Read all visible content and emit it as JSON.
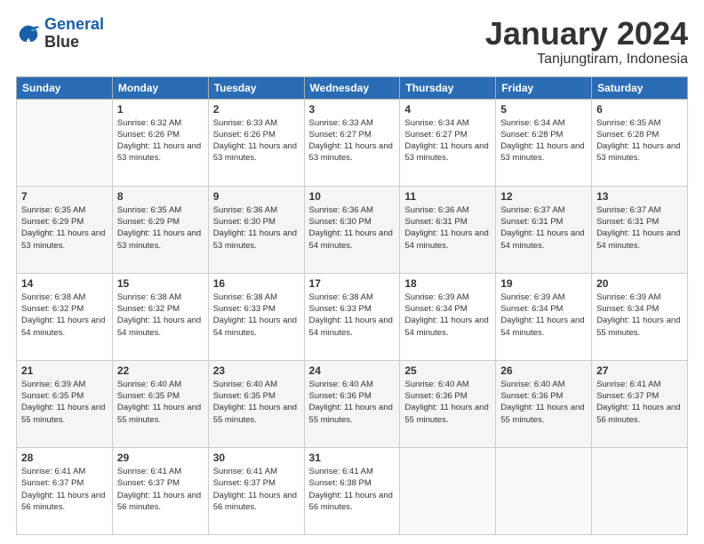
{
  "header": {
    "logo_line1": "General",
    "logo_line2": "Blue",
    "title": "January 2024",
    "subtitle": "Tanjungtiram, Indonesia"
  },
  "days_of_week": [
    "Sunday",
    "Monday",
    "Tuesday",
    "Wednesday",
    "Thursday",
    "Friday",
    "Saturday"
  ],
  "weeks": [
    [
      {
        "day": "",
        "sunrise": "",
        "sunset": "",
        "daylight": ""
      },
      {
        "day": "1",
        "sunrise": "6:32 AM",
        "sunset": "6:26 PM",
        "daylight": "11 hours and 53 minutes."
      },
      {
        "day": "2",
        "sunrise": "6:33 AM",
        "sunset": "6:26 PM",
        "daylight": "11 hours and 53 minutes."
      },
      {
        "day": "3",
        "sunrise": "6:33 AM",
        "sunset": "6:27 PM",
        "daylight": "11 hours and 53 minutes."
      },
      {
        "day": "4",
        "sunrise": "6:34 AM",
        "sunset": "6:27 PM",
        "daylight": "11 hours and 53 minutes."
      },
      {
        "day": "5",
        "sunrise": "6:34 AM",
        "sunset": "6:28 PM",
        "daylight": "11 hours and 53 minutes."
      },
      {
        "day": "6",
        "sunrise": "6:35 AM",
        "sunset": "6:28 PM",
        "daylight": "11 hours and 53 minutes."
      }
    ],
    [
      {
        "day": "7",
        "sunrise": "6:35 AM",
        "sunset": "6:29 PM",
        "daylight": "11 hours and 53 minutes."
      },
      {
        "day": "8",
        "sunrise": "6:35 AM",
        "sunset": "6:29 PM",
        "daylight": "11 hours and 53 minutes."
      },
      {
        "day": "9",
        "sunrise": "6:36 AM",
        "sunset": "6:30 PM",
        "daylight": "11 hours and 53 minutes."
      },
      {
        "day": "10",
        "sunrise": "6:36 AM",
        "sunset": "6:30 PM",
        "daylight": "11 hours and 54 minutes."
      },
      {
        "day": "11",
        "sunrise": "6:36 AM",
        "sunset": "6:31 PM",
        "daylight": "11 hours and 54 minutes."
      },
      {
        "day": "12",
        "sunrise": "6:37 AM",
        "sunset": "6:31 PM",
        "daylight": "11 hours and 54 minutes."
      },
      {
        "day": "13",
        "sunrise": "6:37 AM",
        "sunset": "6:31 PM",
        "daylight": "11 hours and 54 minutes."
      }
    ],
    [
      {
        "day": "14",
        "sunrise": "6:38 AM",
        "sunset": "6:32 PM",
        "daylight": "11 hours and 54 minutes."
      },
      {
        "day": "15",
        "sunrise": "6:38 AM",
        "sunset": "6:32 PM",
        "daylight": "11 hours and 54 minutes."
      },
      {
        "day": "16",
        "sunrise": "6:38 AM",
        "sunset": "6:33 PM",
        "daylight": "11 hours and 54 minutes."
      },
      {
        "day": "17",
        "sunrise": "6:38 AM",
        "sunset": "6:33 PM",
        "daylight": "11 hours and 54 minutes."
      },
      {
        "day": "18",
        "sunrise": "6:39 AM",
        "sunset": "6:34 PM",
        "daylight": "11 hours and 54 minutes."
      },
      {
        "day": "19",
        "sunrise": "6:39 AM",
        "sunset": "6:34 PM",
        "daylight": "11 hours and 54 minutes."
      },
      {
        "day": "20",
        "sunrise": "6:39 AM",
        "sunset": "6:34 PM",
        "daylight": "11 hours and 55 minutes."
      }
    ],
    [
      {
        "day": "21",
        "sunrise": "6:39 AM",
        "sunset": "6:35 PM",
        "daylight": "11 hours and 55 minutes."
      },
      {
        "day": "22",
        "sunrise": "6:40 AM",
        "sunset": "6:35 PM",
        "daylight": "11 hours and 55 minutes."
      },
      {
        "day": "23",
        "sunrise": "6:40 AM",
        "sunset": "6:35 PM",
        "daylight": "11 hours and 55 minutes."
      },
      {
        "day": "24",
        "sunrise": "6:40 AM",
        "sunset": "6:36 PM",
        "daylight": "11 hours and 55 minutes."
      },
      {
        "day": "25",
        "sunrise": "6:40 AM",
        "sunset": "6:36 PM",
        "daylight": "11 hours and 55 minutes."
      },
      {
        "day": "26",
        "sunrise": "6:40 AM",
        "sunset": "6:36 PM",
        "daylight": "11 hours and 55 minutes."
      },
      {
        "day": "27",
        "sunrise": "6:41 AM",
        "sunset": "6:37 PM",
        "daylight": "11 hours and 56 minutes."
      }
    ],
    [
      {
        "day": "28",
        "sunrise": "6:41 AM",
        "sunset": "6:37 PM",
        "daylight": "11 hours and 56 minutes."
      },
      {
        "day": "29",
        "sunrise": "6:41 AM",
        "sunset": "6:37 PM",
        "daylight": "11 hours and 56 minutes."
      },
      {
        "day": "30",
        "sunrise": "6:41 AM",
        "sunset": "6:37 PM",
        "daylight": "11 hours and 56 minutes."
      },
      {
        "day": "31",
        "sunrise": "6:41 AM",
        "sunset": "6:38 PM",
        "daylight": "11 hours and 56 minutes."
      },
      {
        "day": "",
        "sunrise": "",
        "sunset": "",
        "daylight": ""
      },
      {
        "day": "",
        "sunrise": "",
        "sunset": "",
        "daylight": ""
      },
      {
        "day": "",
        "sunrise": "",
        "sunset": "",
        "daylight": ""
      }
    ]
  ]
}
